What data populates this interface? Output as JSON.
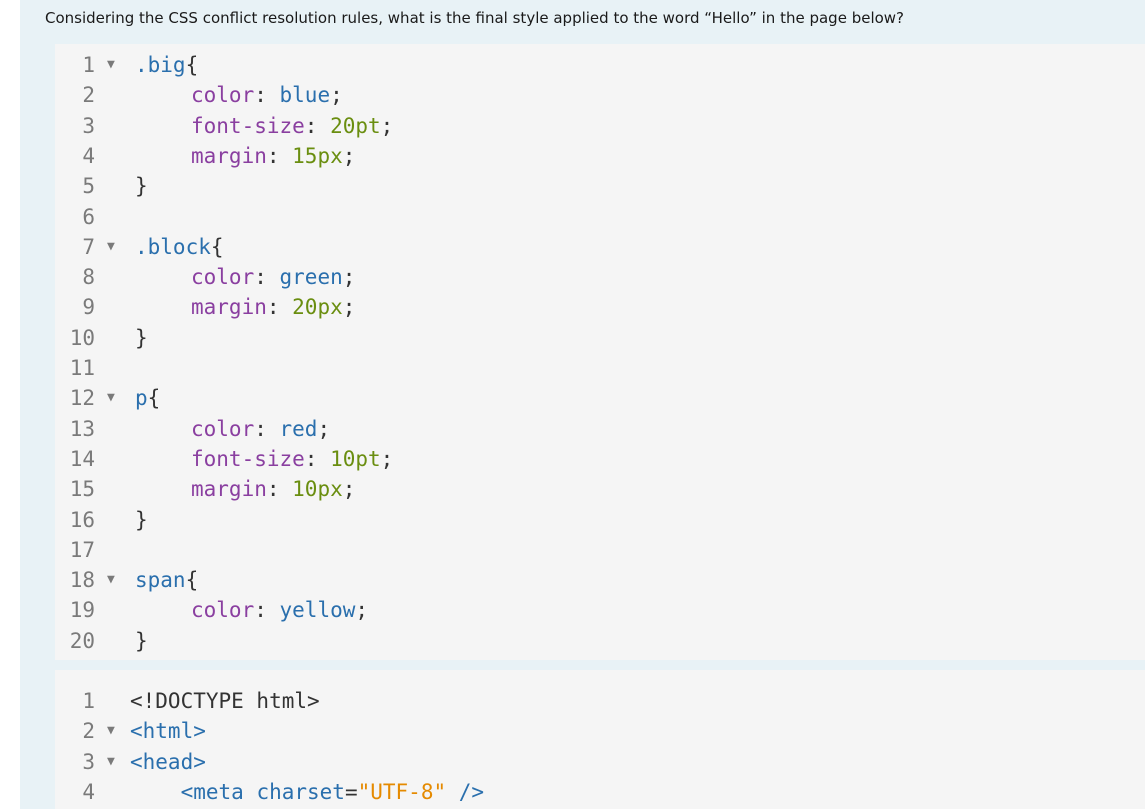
{
  "question": "Considering the CSS conflict resolution rules, what is the final style applied to the word “Hello” in the page below?",
  "fold_glyph": "▼",
  "css_code": [
    {
      "n": "1",
      "fold": true,
      "indent": 0,
      "tokens": [
        {
          "t": ".big",
          "c": "sel"
        },
        {
          "t": "{",
          "c": "punc"
        }
      ]
    },
    {
      "n": "2",
      "fold": false,
      "indent": 1,
      "tokens": [
        {
          "t": "color",
          "c": "prop"
        },
        {
          "t": ": ",
          "c": "punc"
        },
        {
          "t": "blue",
          "c": "val"
        },
        {
          "t": ";",
          "c": "punc"
        }
      ]
    },
    {
      "n": "3",
      "fold": false,
      "indent": 1,
      "tokens": [
        {
          "t": "font-size",
          "c": "prop"
        },
        {
          "t": ": ",
          "c": "punc"
        },
        {
          "t": "20pt",
          "c": "num"
        },
        {
          "t": ";",
          "c": "punc"
        }
      ]
    },
    {
      "n": "4",
      "fold": false,
      "indent": 1,
      "tokens": [
        {
          "t": "margin",
          "c": "prop"
        },
        {
          "t": ": ",
          "c": "punc"
        },
        {
          "t": "15px",
          "c": "num"
        },
        {
          "t": ";",
          "c": "punc"
        }
      ]
    },
    {
      "n": "5",
      "fold": false,
      "indent": 0,
      "tokens": [
        {
          "t": "}",
          "c": "punc"
        }
      ]
    },
    {
      "n": "6",
      "fold": false,
      "indent": 0,
      "tokens": []
    },
    {
      "n": "7",
      "fold": true,
      "indent": 0,
      "tokens": [
        {
          "t": ".block",
          "c": "sel"
        },
        {
          "t": "{",
          "c": "punc"
        }
      ]
    },
    {
      "n": "8",
      "fold": false,
      "indent": 1,
      "tokens": [
        {
          "t": "color",
          "c": "prop"
        },
        {
          "t": ": ",
          "c": "punc"
        },
        {
          "t": "green",
          "c": "val"
        },
        {
          "t": ";",
          "c": "punc"
        }
      ]
    },
    {
      "n": "9",
      "fold": false,
      "indent": 1,
      "tokens": [
        {
          "t": "margin",
          "c": "prop"
        },
        {
          "t": ": ",
          "c": "punc"
        },
        {
          "t": "20px",
          "c": "num"
        },
        {
          "t": ";",
          "c": "punc"
        }
      ]
    },
    {
      "n": "10",
      "fold": false,
      "indent": 0,
      "tokens": [
        {
          "t": "}",
          "c": "punc"
        }
      ]
    },
    {
      "n": "11",
      "fold": false,
      "indent": 0,
      "tokens": []
    },
    {
      "n": "12",
      "fold": true,
      "indent": 0,
      "tokens": [
        {
          "t": "p",
          "c": "sel"
        },
        {
          "t": "{",
          "c": "punc"
        }
      ]
    },
    {
      "n": "13",
      "fold": false,
      "indent": 1,
      "tokens": [
        {
          "t": "color",
          "c": "prop"
        },
        {
          "t": ": ",
          "c": "punc"
        },
        {
          "t": "red",
          "c": "val"
        },
        {
          "t": ";",
          "c": "punc"
        }
      ]
    },
    {
      "n": "14",
      "fold": false,
      "indent": 1,
      "tokens": [
        {
          "t": "font-size",
          "c": "prop"
        },
        {
          "t": ": ",
          "c": "punc"
        },
        {
          "t": "10pt",
          "c": "num"
        },
        {
          "t": ";",
          "c": "punc"
        }
      ]
    },
    {
      "n": "15",
      "fold": false,
      "indent": 1,
      "tokens": [
        {
          "t": "margin",
          "c": "prop"
        },
        {
          "t": ": ",
          "c": "punc"
        },
        {
          "t": "10px",
          "c": "num"
        },
        {
          "t": ";",
          "c": "punc"
        }
      ]
    },
    {
      "n": "16",
      "fold": false,
      "indent": 0,
      "tokens": [
        {
          "t": "}",
          "c": "punc"
        }
      ]
    },
    {
      "n": "17",
      "fold": false,
      "indent": 0,
      "tokens": []
    },
    {
      "n": "18",
      "fold": true,
      "indent": 0,
      "tokens": [
        {
          "t": "span",
          "c": "sel"
        },
        {
          "t": "{",
          "c": "punc"
        }
      ]
    },
    {
      "n": "19",
      "fold": false,
      "indent": 1,
      "tokens": [
        {
          "t": "color",
          "c": "prop"
        },
        {
          "t": ": ",
          "c": "punc"
        },
        {
          "t": "yellow",
          "c": "val"
        },
        {
          "t": ";",
          "c": "punc"
        }
      ]
    },
    {
      "n": "20",
      "fold": false,
      "indent": 0,
      "tokens": [
        {
          "t": "}",
          "c": "punc"
        }
      ]
    }
  ],
  "html_code": [
    {
      "n": "1",
      "fold": false,
      "text_tokens": [
        {
          "t": "<!DOCTYPE html>",
          "c": "plain"
        }
      ]
    },
    {
      "n": "2",
      "fold": true,
      "text_tokens": [
        {
          "t": "<html>",
          "c": "tag"
        }
      ]
    },
    {
      "n": "3",
      "fold": true,
      "text_tokens": [
        {
          "t": "<head>",
          "c": "tag"
        }
      ]
    },
    {
      "n": "4",
      "fold": false,
      "text_tokens": [
        {
          "t": "    <meta ",
          "c": "tag"
        },
        {
          "t": "charset",
          "c": "attr"
        },
        {
          "t": "=",
          "c": "punc"
        },
        {
          "t": "\"UTF-8\"",
          "c": "str"
        },
        {
          "t": " />",
          "c": "tag"
        }
      ]
    }
  ]
}
